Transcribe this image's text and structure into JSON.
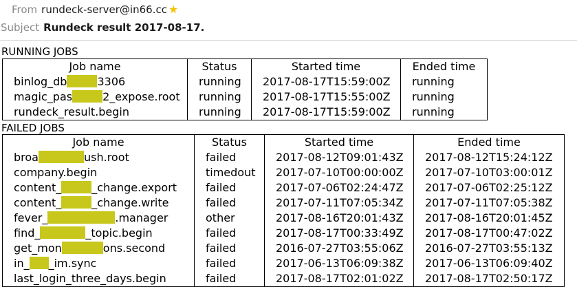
{
  "email": {
    "from_label": "From",
    "from_value": "rundeck-server@in66.cc",
    "subject_label": "Subject",
    "subject_value": "Rundeck result 2017-08-17."
  },
  "running": {
    "title": "RUNNING JOBS",
    "headers": [
      "Job name",
      "Status",
      "Started time",
      "Ended time"
    ],
    "rows": [
      {
        "name_a": "binlog_db",
        "name_b": "3306",
        "status": "running",
        "started": "2017-08-17T15:59:00Z",
        "ended": "running"
      },
      {
        "name_a": "magic_pas",
        "name_b": "2_expose.root",
        "status": "running",
        "started": "2017-08-17T15:55:00Z",
        "ended": "running"
      },
      {
        "name_a": "rundeck_result.begin",
        "name_b": "",
        "status": "running",
        "started": "2017-08-17T15:59:00Z",
        "ended": "running"
      }
    ]
  },
  "failed": {
    "title": "FAILED JOBS",
    "headers": [
      "Job name",
      "Status",
      "Started time",
      "Ended time"
    ],
    "rows": [
      {
        "name_a": "broa",
        "name_b": "ush.root",
        "status": "failed",
        "started": "2017-08-12T09:01:43Z",
        "ended": "2017-08-12T15:24:12Z"
      },
      {
        "name_a": "company.begin",
        "name_b": "",
        "status": "timedout",
        "started": "2017-07-10T00:00:00Z",
        "ended": "2017-07-10T03:00:01Z"
      },
      {
        "name_a": "content_",
        "name_b": "_change.export",
        "status": "failed",
        "started": "2017-07-06T02:24:47Z",
        "ended": "2017-07-06T02:25:12Z"
      },
      {
        "name_a": "content_",
        "name_b": "_change.write",
        "status": "failed",
        "started": "2017-07-11T07:05:34Z",
        "ended": "2017-07-11T07:05:38Z"
      },
      {
        "name_a": "fever_",
        "name_b": ".manager",
        "status": "other",
        "started": "2017-08-16T20:01:43Z",
        "ended": "2017-08-16T20:01:45Z"
      },
      {
        "name_a": "find_",
        "name_b": "_topic.begin",
        "status": "failed",
        "started": "2017-08-17T00:33:49Z",
        "ended": "2017-08-17T00:47:02Z"
      },
      {
        "name_a": "get_mon",
        "name_b": "ons.second",
        "status": "failed",
        "started": "2016-07-27T03:55:06Z",
        "ended": "2016-07-27T03:55:13Z"
      },
      {
        "name_a": "in_",
        "name_b": "_im.sync",
        "status": "failed",
        "started": "2017-06-13T06:09:38Z",
        "ended": "2017-06-13T06:09:40Z"
      },
      {
        "name_a": "last_login_three_days.begin",
        "name_b": "",
        "status": "failed",
        "started": "2017-08-17T02:01:02Z",
        "ended": "2017-08-17T02:50:17Z"
      }
    ]
  },
  "colors": {
    "redaction": "#c8c81c",
    "star": "#f5c400",
    "header_label": "#8a8a8a"
  },
  "icons": {
    "star": "star-icon"
  }
}
